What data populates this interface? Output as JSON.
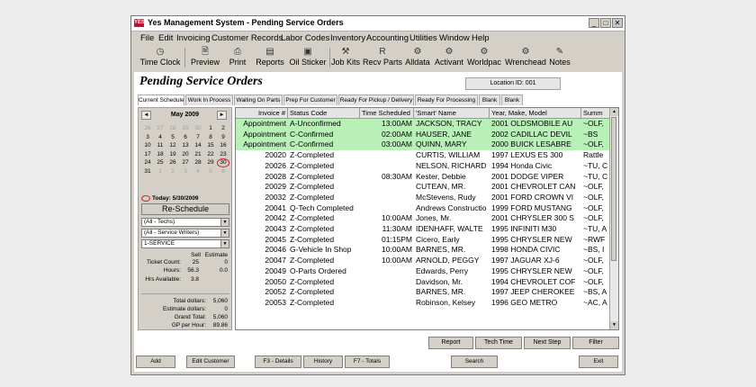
{
  "window": {
    "title": "Yes Management System - Pending Service Orders",
    "icon_text": "YES"
  },
  "menu": [
    "File",
    "Edit",
    "Invoicing",
    "Customer Records",
    "Labor Codes",
    "Inventory",
    "Accounting",
    "Utilities",
    "Window",
    "Help"
  ],
  "toolbar": [
    {
      "label": "Time Clock",
      "icon": "clock-icon",
      "glyph": "◷"
    },
    {
      "label": "Preview",
      "icon": "preview-icon",
      "glyph": "🗎"
    },
    {
      "label": "Print",
      "icon": "printer-icon",
      "glyph": "⎙"
    },
    {
      "label": "Reports",
      "icon": "reports-icon",
      "glyph": "▤"
    },
    {
      "label": "Oil Sticker",
      "icon": "oil-sticker-icon",
      "glyph": "▣"
    },
    {
      "label": "Job Kits",
      "icon": "job-kits-icon",
      "glyph": "⚒"
    },
    {
      "label": "Recv Parts",
      "icon": "receive-parts-icon",
      "glyph": "R"
    },
    {
      "label": "Alldata",
      "icon": "alldata-icon",
      "glyph": "⚙"
    },
    {
      "label": "Activant",
      "icon": "activant-icon",
      "glyph": "⚙"
    },
    {
      "label": "Worldpac",
      "icon": "worldpac-icon",
      "glyph": "⚙"
    },
    {
      "label": "Wrenchead",
      "icon": "wrenchead-icon",
      "glyph": "⚙"
    },
    {
      "label": "Notes",
      "icon": "notes-icon",
      "glyph": "✎"
    }
  ],
  "heading": "Pending Service Orders",
  "location": "Location ID: 001",
  "tabs": [
    "Current Schedule",
    "Work In Process",
    "Waiting On Parts",
    "Prep For Customer",
    "Ready For Pickup / Delivery",
    "Ready For Processing",
    "Blank",
    "Blank"
  ],
  "calendar": {
    "month": "May 2009",
    "prev": "◄",
    "next": "►",
    "today_label": "Today: 5/30/2009",
    "days": [
      {
        "d": "26",
        "o": true
      },
      {
        "d": "27",
        "o": true
      },
      {
        "d": "28",
        "o": true
      },
      {
        "d": "29",
        "o": true
      },
      {
        "d": "30",
        "o": true
      },
      {
        "d": "1"
      },
      {
        "d": "2"
      },
      {
        "d": "3"
      },
      {
        "d": "4"
      },
      {
        "d": "5"
      },
      {
        "d": "6"
      },
      {
        "d": "7"
      },
      {
        "d": "8"
      },
      {
        "d": "9"
      },
      {
        "d": "10"
      },
      {
        "d": "11"
      },
      {
        "d": "12"
      },
      {
        "d": "13"
      },
      {
        "d": "14"
      },
      {
        "d": "15"
      },
      {
        "d": "16"
      },
      {
        "d": "17"
      },
      {
        "d": "18"
      },
      {
        "d": "19"
      },
      {
        "d": "20"
      },
      {
        "d": "21"
      },
      {
        "d": "22"
      },
      {
        "d": "23"
      },
      {
        "d": "24"
      },
      {
        "d": "25"
      },
      {
        "d": "26"
      },
      {
        "d": "27"
      },
      {
        "d": "28"
      },
      {
        "d": "29"
      },
      {
        "d": "30",
        "t": true
      },
      {
        "d": "31"
      },
      {
        "d": "1",
        "o": true
      },
      {
        "d": "2",
        "o": true
      },
      {
        "d": "3",
        "o": true
      },
      {
        "d": "4",
        "o": true
      },
      {
        "d": "5",
        "o": true
      },
      {
        "d": "6",
        "o": true
      }
    ]
  },
  "reschedule_label": "Re-Schedule",
  "filters": [
    "(All - Techs)",
    "(All - Service Writers)",
    "1-SERVICE"
  ],
  "stats": {
    "col_sell": "Sell",
    "col_estimate": "Estimate",
    "ticket_count_label": "Ticket Count:",
    "ticket_count_sell": "25",
    "ticket_count_estimate": "0",
    "hours_label": "Hours:",
    "hours_sell": "56.3",
    "hours_estimate": "0.0",
    "hrs_available_label": "Hrs Available:",
    "hrs_available": "3.8",
    "totals": [
      {
        "label": "Total dollars:",
        "value": "5,060"
      },
      {
        "label": "Estimate dollars:",
        "value": "0"
      },
      {
        "label": "Grand Total:",
        "value": "5,060"
      },
      {
        "label": "GP per Hour:",
        "value": "89.86"
      }
    ]
  },
  "grid": {
    "columns": [
      "Invoice #",
      "Status Code",
      "Time Scheduled",
      "'Smart' Name",
      "Year, Make, Model",
      "Summ"
    ],
    "rows": [
      {
        "invoice": "Appointment",
        "status": "A-Unconfirmed",
        "time": "13:00AM",
        "name": "JACKSON, TRACY",
        "vehicle": "2001 OLDSMOBILE AU",
        "summary": "~OLF,",
        "hl": true
      },
      {
        "invoice": "Appointment",
        "status": "C-Confirmed",
        "time": "02:00AM",
        "name": "HAUSER, JANE",
        "vehicle": "2002 CADILLAC DEVIL",
        "summary": "~BS",
        "hl": true
      },
      {
        "invoice": "Appointment",
        "status": "C-Confirmed",
        "time": "03:00AM",
        "name": "QUINN, MARY",
        "vehicle": "2000 BUICK LESABRE",
        "summary": "~OLF,",
        "hl": true
      },
      {
        "invoice": "20020",
        "status": "Z-Completed",
        "time": "",
        "name": "CURTIS, WILLIAM",
        "vehicle": "1997 LEXUS ES 300",
        "summary": "Rattle"
      },
      {
        "invoice": "20026",
        "status": "Z-Completed",
        "time": "",
        "name": "NELSON, RICHARD",
        "vehicle": "1994 Honda Civic",
        "summary": "~TU, C"
      },
      {
        "invoice": "20028",
        "status": "Z-Completed",
        "time": "08:30AM",
        "name": "Kester, Debbie",
        "vehicle": "2001 DODGE VIPER",
        "summary": "~TU, C"
      },
      {
        "invoice": "20029",
        "status": "Z-Completed",
        "time": "",
        "name": "CUTEAN, MR.",
        "vehicle": "2001 CHEVROLET CAN",
        "summary": "~OLF,"
      },
      {
        "invoice": "20032",
        "status": "Z-Completed",
        "time": "",
        "name": "McStevens, Rudy",
        "vehicle": "2001 FORD CROWN VI",
        "summary": "~OLF,"
      },
      {
        "invoice": "20041",
        "status": "Q-Tech Completed",
        "time": "",
        "name": "Andrews Constructio",
        "vehicle": "1999 FORD MUSTANG",
        "summary": "~OLF,"
      },
      {
        "invoice": "20042",
        "status": "Z-Completed",
        "time": "10:00AM",
        "name": "Jones, Mr.",
        "vehicle": "2001 CHRYSLER 300 S",
        "summary": "~OLF,"
      },
      {
        "invoice": "20043",
        "status": "Z-Completed",
        "time": "11:30AM",
        "name": "IDENHAFF, WALTE",
        "vehicle": "1995 INFINITI M30",
        "summary": "~TU, A"
      },
      {
        "invoice": "20045",
        "status": "Z-Completed",
        "time": "01:15PM",
        "name": "Cicero, Early",
        "vehicle": "1995 CHRYSLER NEW",
        "summary": "~RWF"
      },
      {
        "invoice": "20046",
        "status": "G-Vehicle In Shop",
        "time": "10:00AM",
        "name": "BARNES, MR.",
        "vehicle": "1998 HONDA CIVIC",
        "summary": "~BS, I"
      },
      {
        "invoice": "20047",
        "status": "Z-Completed",
        "time": "10:00AM",
        "name": "ARNOLD, PEGGY",
        "vehicle": "1997 JAGUAR XJ-6",
        "summary": "~OLF,"
      },
      {
        "invoice": "20049",
        "status": "O-Parts Ordered",
        "time": "",
        "name": "Edwards, Perry",
        "vehicle": "1995 CHRYSLER NEW",
        "summary": "~OLF,"
      },
      {
        "invoice": "20050",
        "status": "Z-Completed",
        "time": "",
        "name": "Davidson, Mr.",
        "vehicle": "1994 CHEVROLET COF",
        "summary": "~OLF,"
      },
      {
        "invoice": "20052",
        "status": "Z-Completed",
        "time": "",
        "name": "BARNES, MR.",
        "vehicle": "1997 JEEP CHEROKEE",
        "summary": "~BS, A"
      },
      {
        "invoice": "20053",
        "status": "Z-Completed",
        "time": "",
        "name": "Robinson, Kelsey",
        "vehicle": "1996 GEO METRO",
        "summary": "~AC, A"
      }
    ]
  },
  "actions": [
    "Report",
    "Tech Time",
    "Next Step",
    "Filter"
  ],
  "bottom_buttons": [
    "Add",
    "Edit Customer",
    "F3 - Details",
    "History",
    "F7 - Totals",
    "Search",
    "Exit"
  ],
  "colors": {
    "highlight_row": "#b8f0b8",
    "today_circle": "#d42020"
  }
}
